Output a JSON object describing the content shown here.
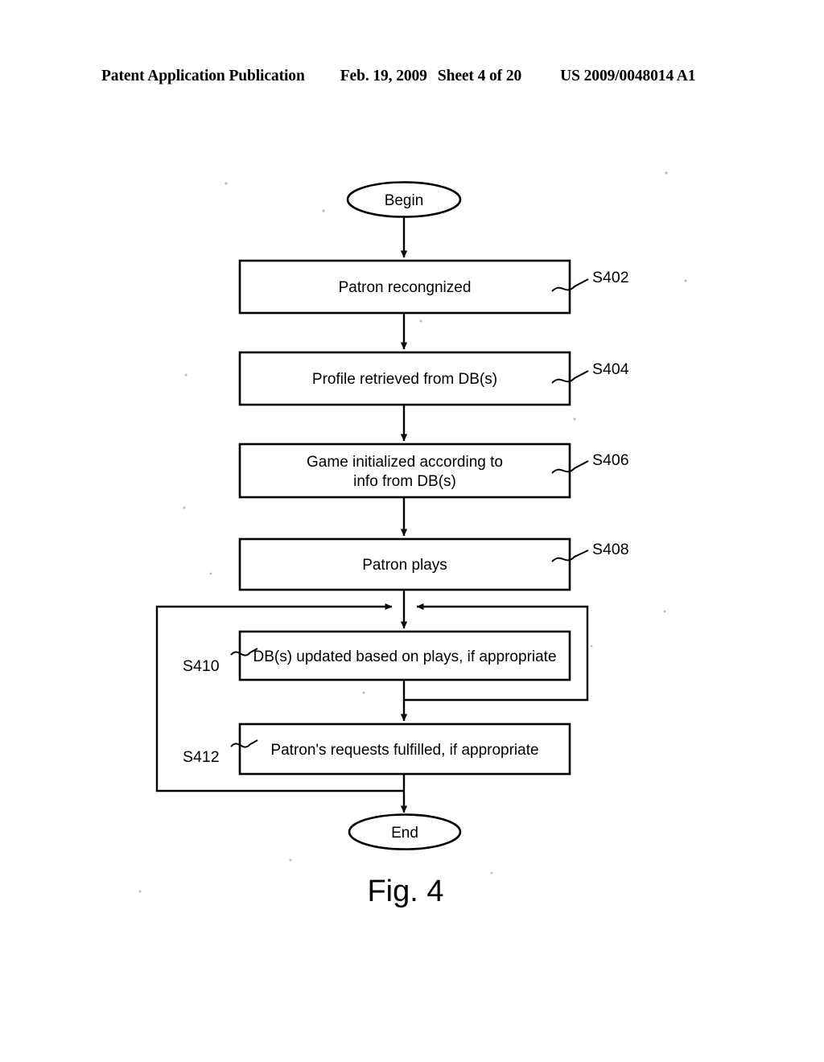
{
  "header": {
    "publication": "Patent Application Publication",
    "date": "Feb. 19, 2009",
    "sheet": "Sheet 4 of 20",
    "patent_number": "US 2009/0048014 A1"
  },
  "figure": {
    "caption": "Fig. 4",
    "terminals": {
      "begin": "Begin",
      "end": "End"
    },
    "steps": [
      {
        "ref": "S402",
        "text": "Patron recongnized",
        "ref_side": "right"
      },
      {
        "ref": "S404",
        "text": "Profile retrieved from DB(s)",
        "ref_side": "right"
      },
      {
        "ref": "S406",
        "text_line1": "Game initialized according to",
        "text_line2": "info from DB(s)",
        "ref_side": "right"
      },
      {
        "ref": "S408",
        "text": "Patron plays",
        "ref_side": "right"
      },
      {
        "ref": "S410",
        "text": "DB(s) updated based on plays, if appropriate",
        "ref_side": "left"
      },
      {
        "ref": "S412",
        "text": "Patron's requests fulfilled, if appropriate",
        "ref_side": "left"
      }
    ]
  },
  "colors": {
    "ink": "#000000",
    "paper": "#ffffff"
  }
}
